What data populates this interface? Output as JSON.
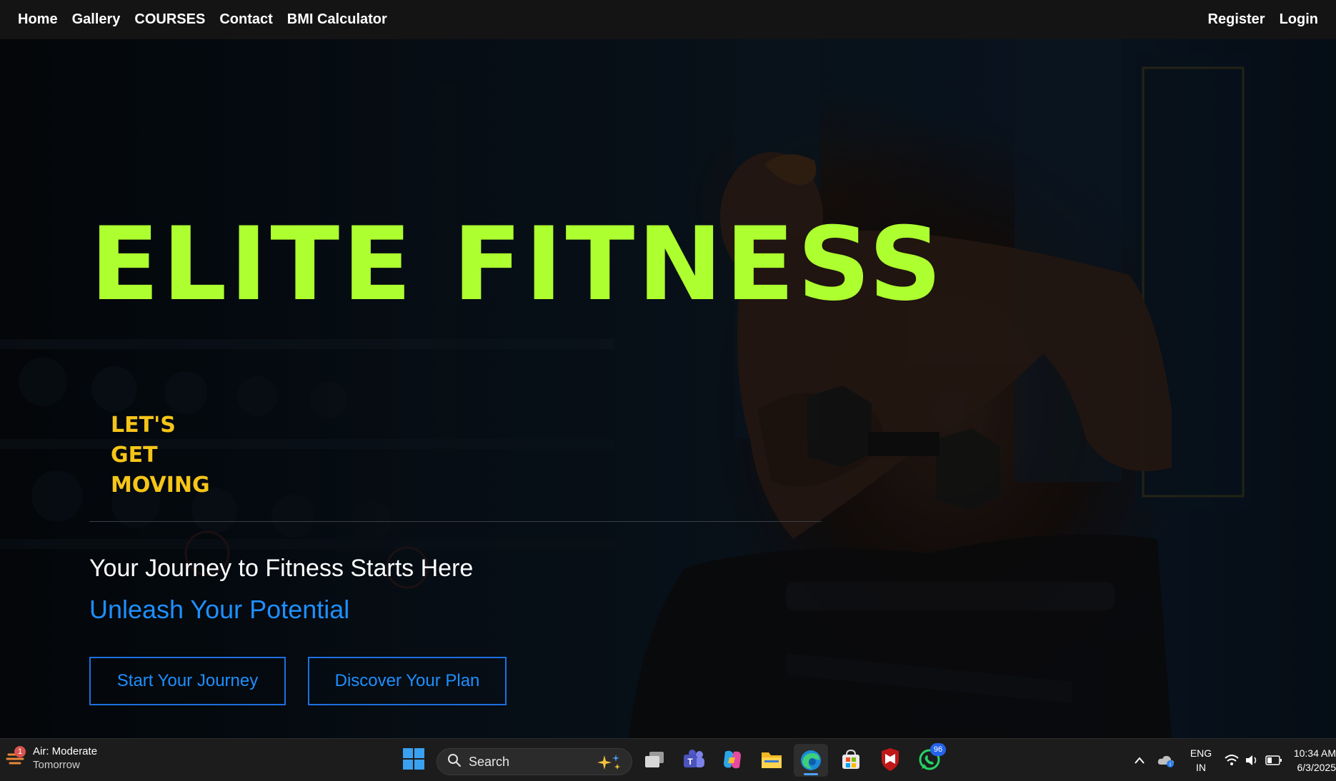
{
  "nav": {
    "left": [
      {
        "label": "Home"
      },
      {
        "label": "Gallery"
      },
      {
        "label": "COURSES"
      },
      {
        "label": "Contact"
      },
      {
        "label": "BMI Calculator"
      }
    ],
    "right": [
      {
        "label": "Register"
      },
      {
        "label": "Login"
      }
    ]
  },
  "hero": {
    "title": "ELITE FITNESS",
    "tagline": [
      "LET'S",
      "GET",
      "MOVING"
    ],
    "subtitle": "Your Journey to Fitness Starts Here",
    "subtitle_accent": "Unleash Your Potential",
    "buttons": {
      "start": "Start Your Journey",
      "discover": "Discover Your Plan"
    }
  },
  "colors": {
    "title": "#adff2f",
    "tagline": "#f5c518",
    "accent": "#1e8fff",
    "nav_bg": "#141414",
    "taskbar_bg": "#1c1c1c"
  },
  "taskbar": {
    "weather": {
      "title": "Air: Moderate",
      "subtitle": "Tomorrow",
      "badge": "1",
      "icon": "weather-icon"
    },
    "search": {
      "label": "Search"
    },
    "apps": [
      {
        "name": "task-view-icon"
      },
      {
        "name": "teams-icon"
      },
      {
        "name": "copilot-icon"
      },
      {
        "name": "file-explorer-icon"
      },
      {
        "name": "edge-icon",
        "active": true
      },
      {
        "name": "store-icon"
      },
      {
        "name": "mcafee-icon"
      },
      {
        "name": "whatsapp-icon",
        "badge": "96"
      }
    ],
    "tray": {
      "lang_top": "ENG",
      "lang_bottom": "IN",
      "time": "10:34 AM",
      "date": "6/3/2025"
    }
  }
}
